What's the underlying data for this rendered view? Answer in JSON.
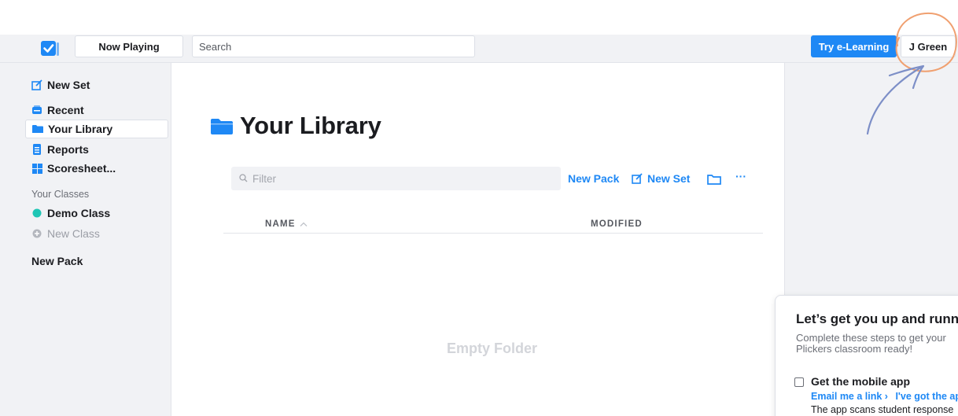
{
  "topbar": {
    "now_playing_label": "Now Playing",
    "search_placeholder": "Search",
    "try_label": "Try e-Learning",
    "user_label": "J Green"
  },
  "sidebar": {
    "items": [
      {
        "label": "New Set",
        "icon": "edit-icon"
      },
      {
        "label": "Recent",
        "icon": "recent-icon"
      },
      {
        "label": "Your Library",
        "icon": "folder-icon",
        "active": true
      },
      {
        "label": "Reports",
        "icon": "reports-icon"
      },
      {
        "label": "Scoresheet...",
        "icon": "grid-icon"
      }
    ],
    "classes_heading": "Your Classes",
    "demo_class": "Demo Class",
    "new_class": "New Class",
    "new_pack": "New Pack"
  },
  "main": {
    "title": "Your Library",
    "filter_placeholder": "Filter",
    "new_pack": "New Pack",
    "new_set": "New Set",
    "more": "···",
    "col_name": "NAME",
    "col_modified": "MODIFIED",
    "empty": "Empty Folder"
  },
  "onboarding": {
    "title": "Let’s get you up and runn",
    "subtitle": "Complete these steps to get your Plickers classroom ready!",
    "step_title": "Get the mobile app",
    "link_email": "Email me a link ›",
    "link_got": "I've got the ap",
    "desc": "The app scans student response"
  },
  "colors": {
    "accent": "#1e88f5",
    "demo_class_dot": "#1fc6b5",
    "annotation": "#f0a070",
    "arrow": "#7d8fc7"
  }
}
